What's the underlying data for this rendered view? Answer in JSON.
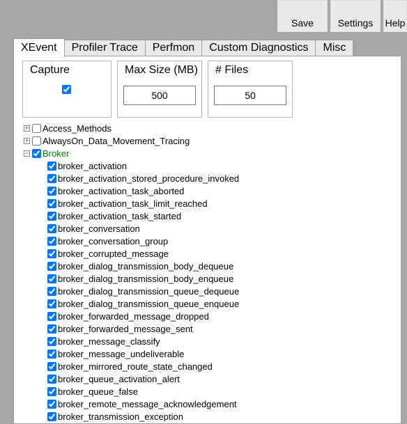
{
  "toolbar": {
    "save": "Save",
    "settings": "Settings",
    "help": "Help"
  },
  "tabs": {
    "t0": "XEvent",
    "t1": "Profiler Trace",
    "t2": "Perfmon",
    "t3": "Custom Diagnostics",
    "t4": "Misc"
  },
  "groups": {
    "capture_label": "Capture",
    "maxsize_label": "Max Size (MB)",
    "maxsize_value": "500",
    "files_label": "# Files",
    "files_value": "50"
  },
  "tree": {
    "roots": [
      {
        "label": "Access_Methods",
        "checked": false,
        "expander": "+"
      },
      {
        "label": "AlwaysOn_Data_Movement_Tracing",
        "checked": false,
        "expander": "+"
      },
      {
        "label": "Broker",
        "checked": true,
        "expander": "−",
        "green": true
      }
    ],
    "broker_children": [
      "broker_activation",
      "broker_activation_stored_procedure_invoked",
      "broker_activation_task_aborted",
      "broker_activation_task_limit_reached",
      "broker_activation_task_started",
      "broker_conversation",
      "broker_conversation_group",
      "broker_corrupted_message",
      "broker_dialog_transmission_body_dequeue",
      "broker_dialog_transmission_body_enqueue",
      "broker_dialog_transmission_queue_dequeue",
      "broker_dialog_transmission_queue_enqueue",
      "broker_forwarded_message_dropped",
      "broker_forwarded_message_sent",
      "broker_message_classify",
      "broker_message_undeliverable",
      "broker_mirrored_route_state_changed",
      "broker_queue_activation_alert",
      "broker_queue_false",
      "broker_remote_message_acknowledgement",
      "broker_transmission_exception"
    ]
  }
}
